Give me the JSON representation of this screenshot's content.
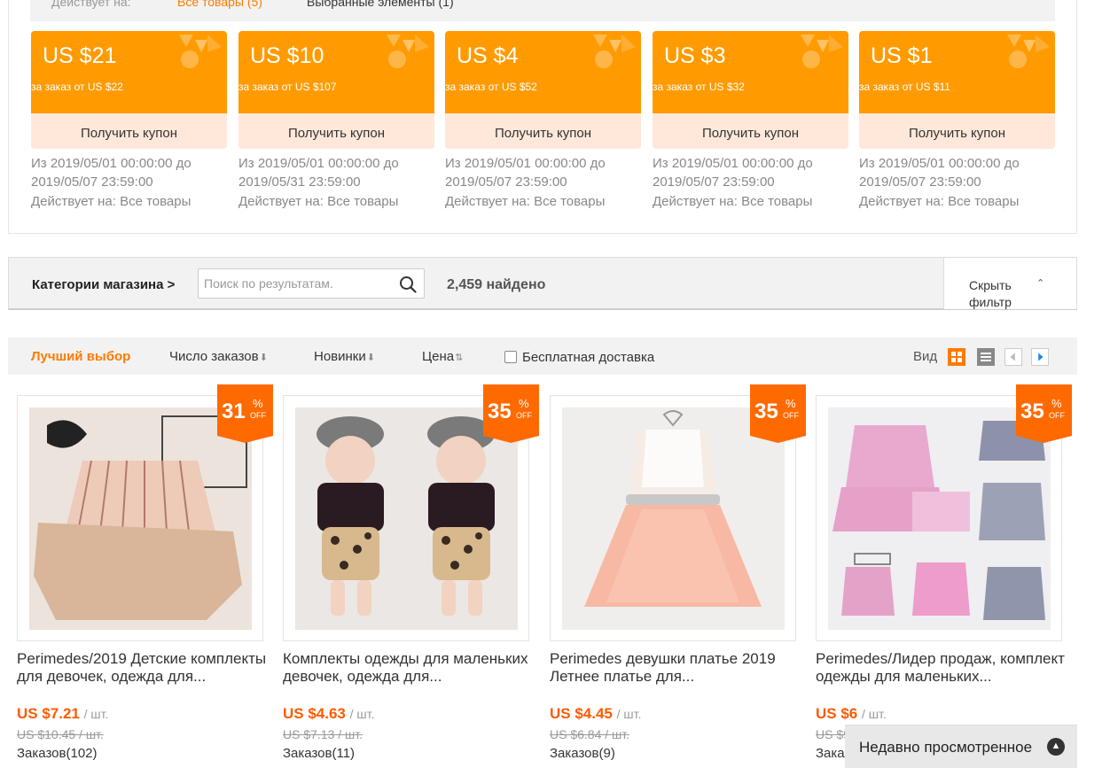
{
  "top_strip": {
    "label": "Действует на:",
    "all_items": "Все товары (5)",
    "selected_items": "Выбранные элементы (1)"
  },
  "coupons": [
    {
      "amount": "US $21",
      "min_order": "за заказ от US $22",
      "get_label": "Получить купон",
      "period": "Из 2019/05/01 00:00:00 до 2019/05/07 23:59:00",
      "applies": "Действует на: Все товары"
    },
    {
      "amount": "US $10",
      "min_order": "за заказ от US $107",
      "get_label": "Получить купон",
      "period": "Из 2019/05/01 00:00:00 до 2019/05/31 23:59:00",
      "applies": "Действует на: Все товары"
    },
    {
      "amount": "US $4",
      "min_order": "за заказ от US $52",
      "get_label": "Получить купон",
      "period": "Из 2019/05/01 00:00:00 до 2019/05/07 23:59:00",
      "applies": "Действует на: Все товары"
    },
    {
      "amount": "US $3",
      "min_order": "за заказ от US $32",
      "get_label": "Получить купон",
      "period": "Из 2019/05/01 00:00:00 до 2019/05/07 23:59:00",
      "applies": "Действует на: Все товары"
    },
    {
      "amount": "US $1",
      "min_order": "за заказ от US $11",
      "get_label": "Получить купон",
      "period": "Из 2019/05/01 00:00:00 до 2019/05/07 23:59:00",
      "applies": "Действует на: Все товары"
    }
  ],
  "filter": {
    "categories_link": "Категории магазина >",
    "search_placeholder": "Поиск по результатам.",
    "search_value": "",
    "found": "2,459 найдено",
    "hide_filter": "Скрыть фильтр"
  },
  "sort": {
    "best": "Лучший выбор",
    "orders": "Число заказов",
    "new": "Новинки",
    "price": "Цена",
    "free_shipping": "Бесплатная доставка",
    "view": "Вид"
  },
  "colors": {
    "accent": "#ff7a00",
    "coupon": "#ff9b00",
    "coupon_bottom": "#ffe8d9",
    "price": "#ff5a00"
  },
  "products": [
    {
      "discount": "31",
      "off_pct": "%",
      "off": "OFF",
      "title": "Perimedes/2019 Детские комплекты для девочек, одежда для...",
      "price": "US $7.21",
      "unit": "/ шт.",
      "old_price": "US $10.45 / шт.",
      "orders": "Заказов(102)"
    },
    {
      "discount": "35",
      "off_pct": "%",
      "off": "OFF",
      "title": "Комплекты одежды для маленьких девочек, одежда для...",
      "price": "US $4.63",
      "unit": "/ шт.",
      "old_price": "US $7.13 / шт.",
      "orders": "Заказов(11)"
    },
    {
      "discount": "35",
      "off_pct": "%",
      "off": "OFF",
      "title": "Perimedes девушки платье 2019 Летнее платье для...",
      "price": "US $4.45",
      "unit": "/ шт.",
      "old_price": "US $6.84 / шт.",
      "orders": "Заказов(9)"
    },
    {
      "discount": "35",
      "off_pct": "%",
      "off": "OFF",
      "title": "Perimedes/Лидер продаж, комплект одежды для маленьких...",
      "price": "US $6",
      "unit": "/ шт.",
      "old_price": "US $9.23 / шт.",
      "orders": "Заказов(6)"
    }
  ],
  "recent": {
    "label": "Недавно просмотренное"
  }
}
